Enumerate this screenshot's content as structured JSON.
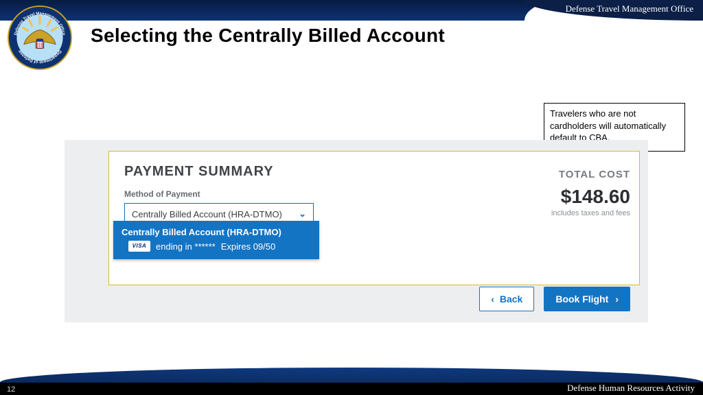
{
  "header": {
    "office_label": "Defense Travel Management Office",
    "slide_title": "Selecting the Centrally Billed Account"
  },
  "callout": {
    "text": "Travelers who are not cardholders will automatically default to CBA."
  },
  "payment": {
    "heading": "PAYMENT SUMMARY",
    "method_label": "Method of Payment",
    "selected": "Centrally Billed Account (HRA-DTMO)",
    "option": {
      "title": "Centrally Billed Account (HRA-DTMO)",
      "card_network": "VISA",
      "ending_in": "ending in ******",
      "expires": "Expires 09/50"
    },
    "total_label": "TOTAL COST",
    "total_amount": "$148.60",
    "total_note": "includes taxes and fees",
    "buttons": {
      "back": "Back",
      "book": "Book Flight"
    }
  },
  "footer": {
    "page_number": "12",
    "activity": "Defense Human Resources Activity"
  },
  "colors": {
    "accent_blue": "#1474c4",
    "accent_yellow": "#d7bb2a",
    "banner_navy": "#0b2a5e"
  }
}
